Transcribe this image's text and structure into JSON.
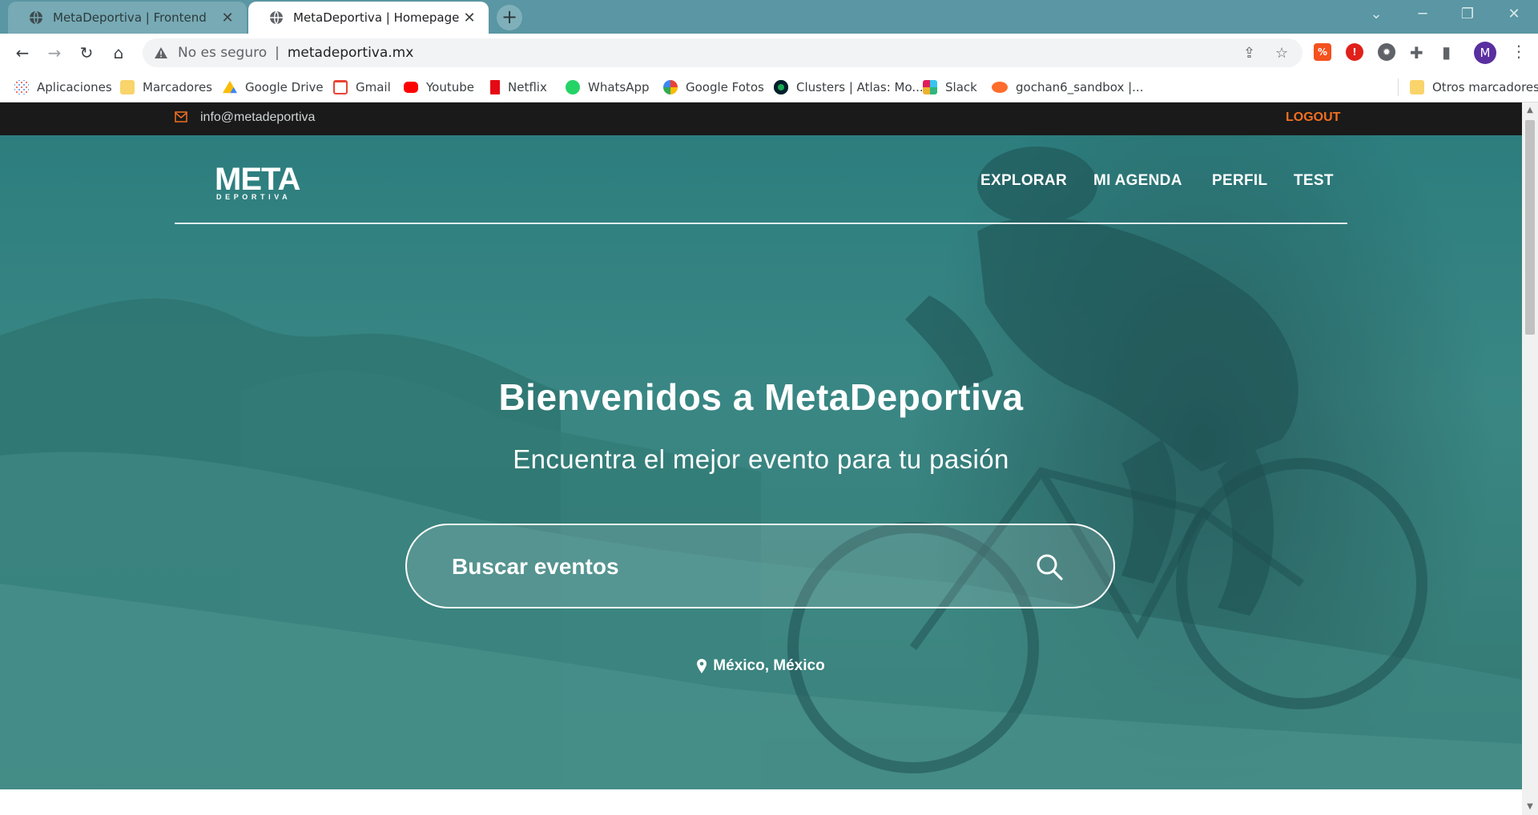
{
  "browser": {
    "tabs": [
      {
        "title": "MetaDeportiva | Frontend",
        "active": false
      },
      {
        "title": "MetaDeportiva | Homepage",
        "active": true
      }
    ],
    "new_tab_label": "+",
    "close_label": "✕",
    "security_label": "No es seguro",
    "url": "metadeportiva.mx",
    "avatar_letter": "M",
    "bookmarks": [
      {
        "label": "Aplicaciones",
        "icon": "apps-grid-icon"
      },
      {
        "label": "Marcadores",
        "icon": "folder-icon"
      },
      {
        "label": "Google Drive",
        "icon": "google-drive-icon"
      },
      {
        "label": "Gmail",
        "icon": "gmail-icon"
      },
      {
        "label": "Youtube",
        "icon": "youtube-icon"
      },
      {
        "label": "Netflix",
        "icon": "netflix-icon"
      },
      {
        "label": "WhatsApp",
        "icon": "whatsapp-icon"
      },
      {
        "label": "Google Fotos",
        "icon": "google-photos-icon"
      },
      {
        "label": "Clusters | Atlas: Mo...",
        "icon": "mongodb-icon"
      },
      {
        "label": "Slack",
        "icon": "slack-icon"
      },
      {
        "label": "gochan6_sandbox |...",
        "icon": "cpanel-icon"
      }
    ],
    "other_bookmarks": "Otros marcadores"
  },
  "site": {
    "email": "info@metadeportiva",
    "logout": "LOGOUT",
    "logo_text": "META",
    "logo_sub": "DEPORTIVA",
    "nav": [
      "EXPLORAR",
      "MI AGENDA",
      "PERFIL",
      "TEST"
    ],
    "hero_title": "Bienvenidos a MetaDeportiva",
    "hero_subtitle": "Encuentra el mejor evento para tu pasión",
    "search_placeholder": "Buscar eventos",
    "location": "México, México"
  },
  "colors": {
    "accent": "#f36f21",
    "topbar": "#1a1a1a",
    "hero_overlay": "#3e8783",
    "tabstrip": "#5a96a3"
  }
}
